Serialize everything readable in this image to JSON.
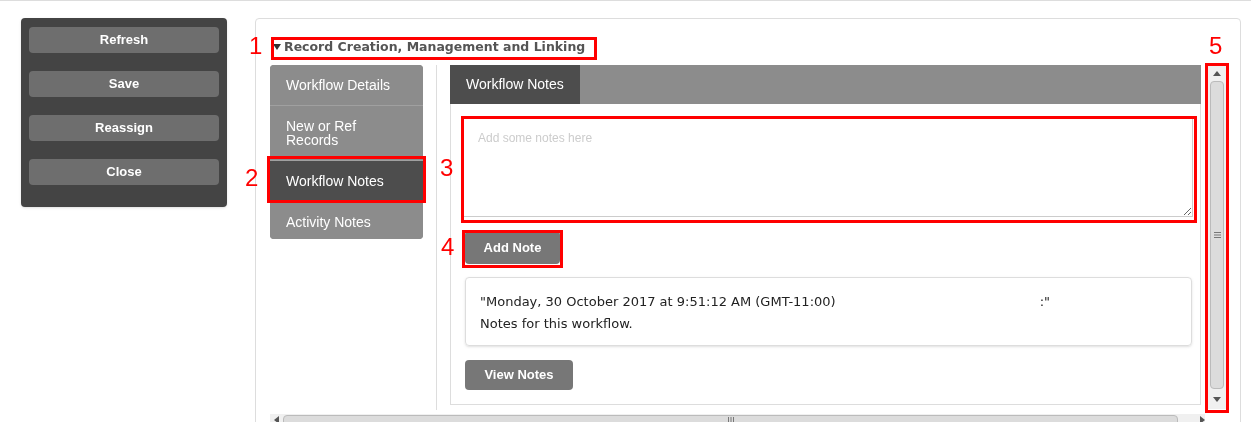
{
  "actions": [
    {
      "label": "Refresh"
    },
    {
      "label": "Save"
    },
    {
      "label": "Reassign"
    },
    {
      "label": "Close"
    }
  ],
  "section": {
    "title": "Record Creation, Management and Linking",
    "expanded": true
  },
  "nav": [
    {
      "label": "Workflow Details",
      "selected": false
    },
    {
      "label": "New or Ref Records",
      "selected": false
    },
    {
      "label": "Workflow Notes",
      "selected": true
    },
    {
      "label": "Activity Notes",
      "selected": false
    }
  ],
  "tabs": [
    {
      "label": "Workflow Notes",
      "selected": true
    }
  ],
  "notes_field": {
    "placeholder": "Add some notes here"
  },
  "add_button": "Add Note",
  "notes": [
    {
      "header": "\"Monday, 30 October 2017 at 9:51:12 AM (GMT-11:00)",
      "suffix": ":\"",
      "text": "Notes for this workflow."
    }
  ],
  "view_button": "View Notes",
  "annotations": [
    {
      "label": "1"
    },
    {
      "label": "2"
    },
    {
      "label": "3"
    },
    {
      "label": "4"
    },
    {
      "label": "5"
    }
  ]
}
